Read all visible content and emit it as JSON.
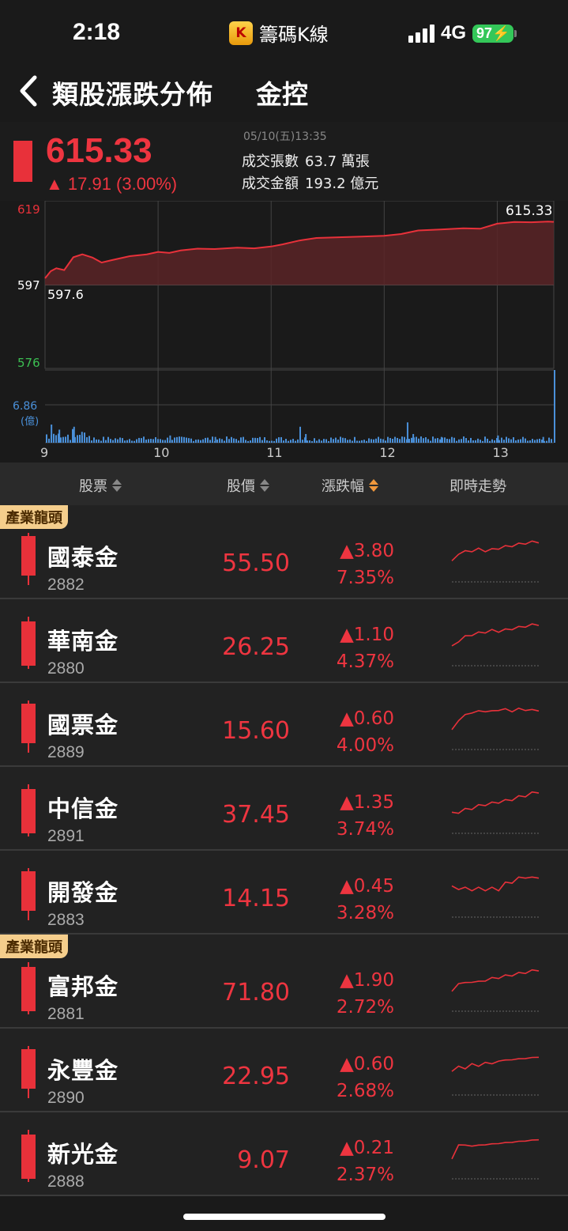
{
  "status_bar": {
    "time": "2:18",
    "app_name": "籌碼K線",
    "logo_letter": "K",
    "network": "4G",
    "battery": "97"
  },
  "nav": {
    "title": "類股漲跌分佈",
    "subtitle": "金控"
  },
  "quote": {
    "price": "615.33",
    "change": "▲ 17.91 (3.00%)",
    "datetime": "05/10(五)13:35",
    "volume_label": "成交張數",
    "volume_value": "63.7 萬張",
    "amount_label": "成交金額",
    "amount_value": "193.2 億元"
  },
  "chart_data": {
    "type": "line",
    "y_labels": {
      "top": "619",
      "mid": "597",
      "bottom": "576",
      "volume_max": "6.86",
      "volume_unit": "(億)"
    },
    "open_label": "597.6",
    "last_label": "615.33",
    "x_ticks": [
      "9",
      "10",
      "11",
      "12",
      "13"
    ],
    "ylim": [
      576,
      619
    ],
    "reference": 597.6,
    "time_range": [
      9,
      13.5
    ],
    "series": [
      {
        "values": [
          [
            9.0,
            599.5
          ],
          [
            9.05,
            601.5
          ],
          [
            9.1,
            602.3
          ],
          [
            9.17,
            601.8
          ],
          [
            9.25,
            605.4
          ],
          [
            9.33,
            606.2
          ],
          [
            9.42,
            605.3
          ],
          [
            9.5,
            603.9
          ],
          [
            9.58,
            604.5
          ],
          [
            9.75,
            605.7
          ],
          [
            9.9,
            606.2
          ],
          [
            10.0,
            606.9
          ],
          [
            10.1,
            606.6
          ],
          [
            10.2,
            607.3
          ],
          [
            10.35,
            607.8
          ],
          [
            10.5,
            607.7
          ],
          [
            10.7,
            608.1
          ],
          [
            10.85,
            607.9
          ],
          [
            11.0,
            608.4
          ],
          [
            11.1,
            609.0
          ],
          [
            11.25,
            610.1
          ],
          [
            11.4,
            610.8
          ],
          [
            11.6,
            611.0
          ],
          [
            11.8,
            611.2
          ],
          [
            12.0,
            611.4
          ],
          [
            12.15,
            611.9
          ],
          [
            12.3,
            612.9
          ],
          [
            12.5,
            613.2
          ],
          [
            12.7,
            613.5
          ],
          [
            12.85,
            613.4
          ],
          [
            13.0,
            614.8
          ],
          [
            13.15,
            615.3
          ],
          [
            13.3,
            615.2
          ],
          [
            13.45,
            615.4
          ],
          [
            13.5,
            615.33
          ]
        ]
      }
    ],
    "volume_spikes": [
      [
        9.05,
        0.25
      ],
      [
        9.12,
        0.18
      ],
      [
        9.25,
        0.22
      ],
      [
        9.32,
        0.15
      ],
      [
        10.1,
        0.1
      ],
      [
        10.5,
        0.08
      ],
      [
        11.25,
        0.22
      ],
      [
        11.3,
        0.12
      ],
      [
        12.2,
        0.28
      ],
      [
        12.25,
        0.12
      ],
      [
        12.5,
        0.08
      ],
      [
        13.0,
        0.1
      ],
      [
        13.4,
        0.08
      ],
      [
        13.5,
        1.0
      ]
    ]
  },
  "columns": {
    "stock": "股票",
    "price": "股價",
    "change": "漲跌幅",
    "trend": "即時走勢"
  },
  "badge_label": "產業龍頭",
  "stocks": [
    {
      "name": "國泰金",
      "code": "2882",
      "price": "55.50",
      "change": "▲3.80",
      "pct": "7.35%",
      "leader": true,
      "spark": [
        0.9,
        0.55,
        0.5,
        0.45,
        0.4,
        0.45,
        0.42,
        0.35,
        0.3,
        0.25,
        0.2,
        0.15,
        0.12,
        0.1
      ]
    },
    {
      "name": "華南金",
      "code": "2880",
      "price": "26.25",
      "change": "▲1.10",
      "pct": "4.37%",
      "leader": false,
      "spark": [
        0.95,
        0.7,
        0.55,
        0.45,
        0.4,
        0.35,
        0.3,
        0.32,
        0.28,
        0.22,
        0.18,
        0.12,
        0.08,
        0.05
      ]
    },
    {
      "name": "國票金",
      "code": "2889",
      "price": "15.60",
      "change": "▲0.60",
      "pct": "4.00%",
      "leader": false,
      "spark": [
        0.95,
        0.5,
        0.35,
        0.2,
        0.2,
        0.15,
        0.2,
        0.1,
        0.12,
        0.15,
        0.1,
        0.1,
        0.15,
        0.12
      ]
    },
    {
      "name": "中信金",
      "code": "2891",
      "price": "37.45",
      "change": "▲1.35",
      "pct": "3.74%",
      "leader": false,
      "spark": [
        0.9,
        0.85,
        0.75,
        0.7,
        0.6,
        0.55,
        0.5,
        0.45,
        0.4,
        0.35,
        0.25,
        0.2,
        0.1,
        0.05
      ]
    },
    {
      "name": "開發金",
      "code": "2883",
      "price": "14.15",
      "change": "▲0.45",
      "pct": "3.28%",
      "leader": false,
      "spark": [
        0.5,
        0.55,
        0.55,
        0.6,
        0.55,
        0.6,
        0.55,
        0.6,
        0.35,
        0.3,
        0.15,
        0.1,
        0.15,
        0.1
      ]
    },
    {
      "name": "富邦金",
      "code": "2881",
      "price": "71.80",
      "change": "▲1.90",
      "pct": "2.72%",
      "leader": true,
      "spark": [
        0.95,
        0.55,
        0.6,
        0.5,
        0.55,
        0.45,
        0.4,
        0.35,
        0.3,
        0.25,
        0.2,
        0.15,
        0.1,
        0.05
      ]
    },
    {
      "name": "永豐金",
      "code": "2890",
      "price": "22.95",
      "change": "▲0.60",
      "pct": "2.68%",
      "leader": false,
      "spark": [
        0.8,
        0.5,
        0.7,
        0.4,
        0.6,
        0.35,
        0.5,
        0.3,
        0.35,
        0.25,
        0.3,
        0.2,
        0.25,
        0.15
      ]
    },
    {
      "name": "新光金",
      "code": "2888",
      "price": "9.07",
      "change": "▲0.21",
      "pct": "2.37%",
      "leader": false,
      "spark": [
        0.95,
        0.3,
        0.4,
        0.35,
        0.4,
        0.3,
        0.35,
        0.25,
        0.3,
        0.2,
        0.25,
        0.15,
        0.2,
        0.1
      ]
    }
  ]
}
